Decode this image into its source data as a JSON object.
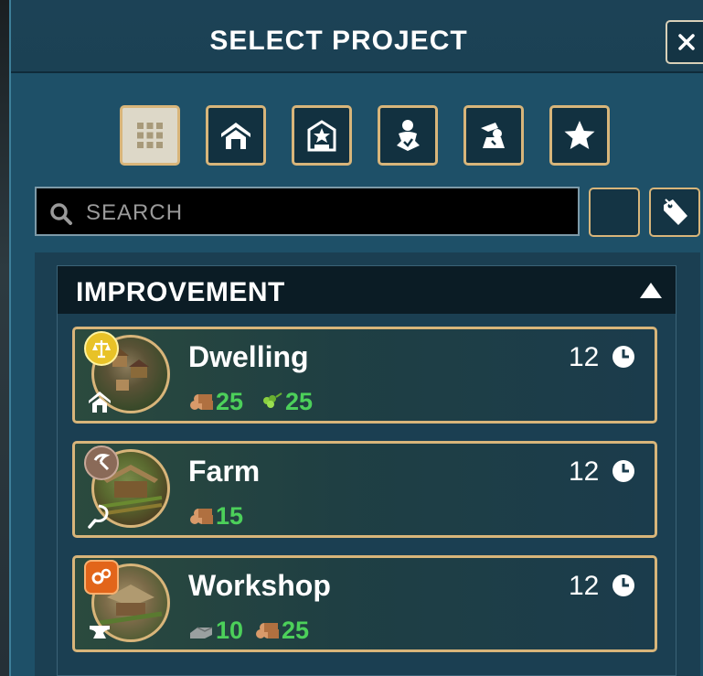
{
  "header": {
    "title": "SELECT PROJECT"
  },
  "icons": {
    "close": "close-icon",
    "filters": [
      "grid-icon",
      "house-icon",
      "guild-icon",
      "worker-icon",
      "builder-icon",
      "star-icon"
    ],
    "search": "search-icon",
    "tag": "tag-icon"
  },
  "search": {
    "placeholder": "SEARCH",
    "value": ""
  },
  "category": {
    "title": "IMPROVEMENT",
    "expanded": true
  },
  "projects": [
    {
      "name": "Dwelling",
      "turns": "12",
      "badge": "scales-icon",
      "type_icon": "house-icon",
      "costs": [
        {
          "icon": "logs-icon",
          "value": "25"
        },
        {
          "icon": "food-icon",
          "value": "25"
        }
      ]
    },
    {
      "name": "Farm",
      "turns": "12",
      "badge": "sickle-icon",
      "type_icon": "sickle-icon",
      "costs": [
        {
          "icon": "logs-icon",
          "value": "15"
        }
      ]
    },
    {
      "name": "Workshop",
      "turns": "12",
      "badge": "gears-icon",
      "type_icon": "anvil-icon",
      "costs": [
        {
          "icon": "stone-icon",
          "value": "10"
        },
        {
          "icon": "logs-icon",
          "value": "25"
        }
      ]
    }
  ],
  "colors": {
    "accent": "#d8b57a",
    "panel": "#1e5068",
    "cost_text": "#4cd05a"
  }
}
